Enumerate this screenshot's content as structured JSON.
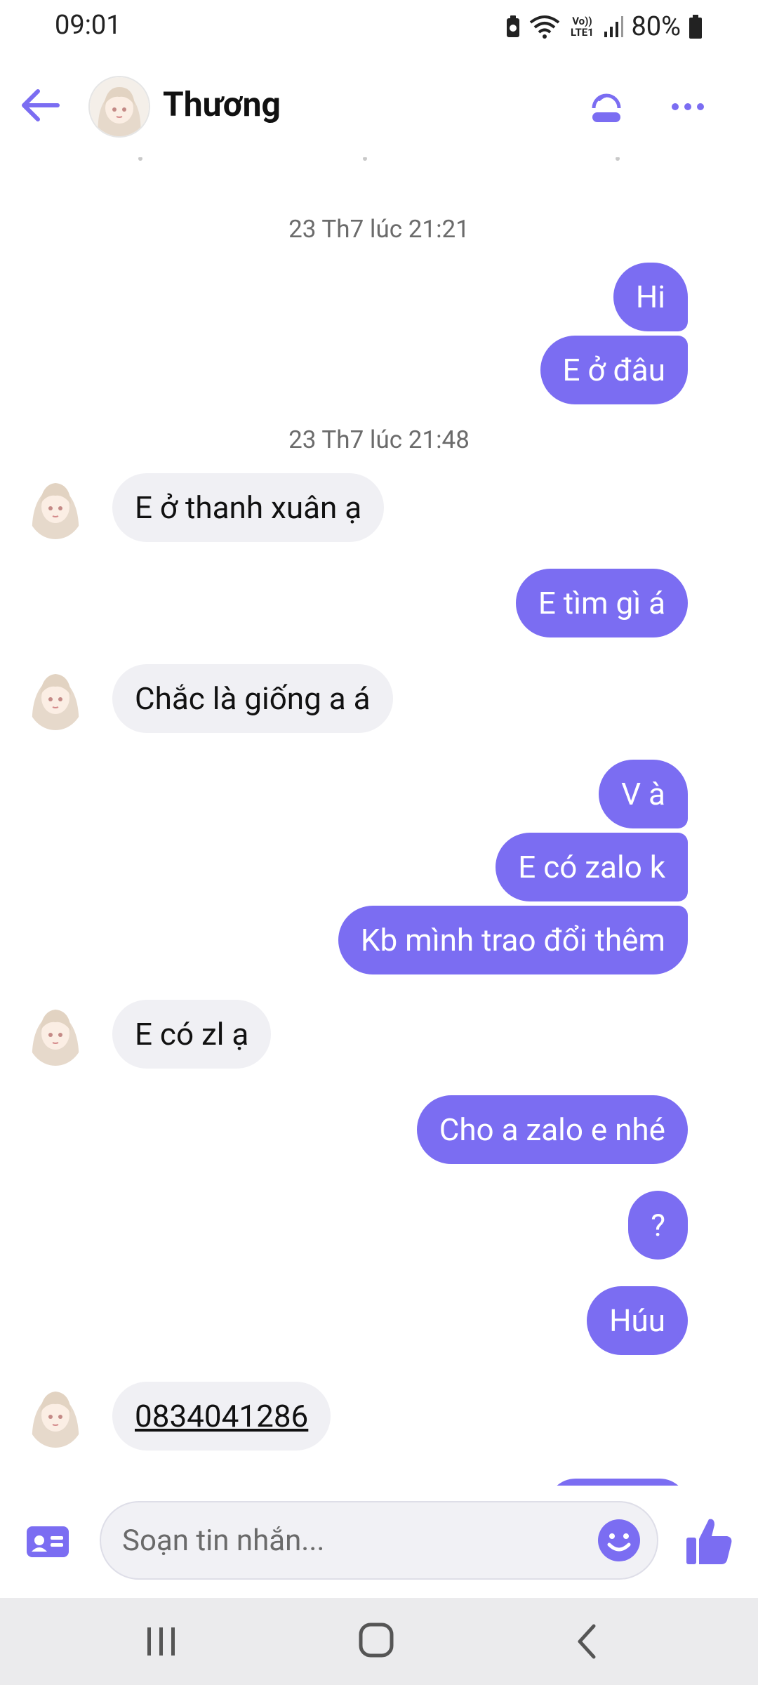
{
  "status": {
    "time": "09:01",
    "network": "Vo)) LTE1",
    "battery": "80%"
  },
  "header": {
    "contact_name": "Thương"
  },
  "composer": {
    "placeholder": "Soạn tin nhắn..."
  },
  "messages": [
    {
      "type": "timestamp",
      "text": "23 Th7 lúc 21:21"
    },
    {
      "type": "outgoing",
      "text": "Hi"
    },
    {
      "type": "outgoing",
      "text": "E ở đâu"
    },
    {
      "type": "timestamp",
      "text": "23 Th7 lúc 21:48"
    },
    {
      "type": "incoming",
      "text": "E ở thanh xuân ạ"
    },
    {
      "type": "outgoing",
      "text": "E tìm gì á"
    },
    {
      "type": "incoming",
      "text": "Chắc là giống a á"
    },
    {
      "type": "outgoing",
      "text": "V à"
    },
    {
      "type": "outgoing",
      "text": "E có zalo k"
    },
    {
      "type": "outgoing",
      "text": "Kb mình trao đổi thêm"
    },
    {
      "type": "incoming",
      "text": "E có zl ạ"
    },
    {
      "type": "outgoing",
      "text": "Cho a zalo e nhé"
    },
    {
      "type": "outgoing",
      "text": "?"
    },
    {
      "type": "outgoing",
      "text": "Húu"
    },
    {
      "type": "incoming",
      "text": "0834041286"
    }
  ],
  "colors": {
    "accent": "#7b6df2",
    "incoming_bubble": "#f0f0f4",
    "navbar": "#ebebed"
  },
  "icons": [
    "back-arrow-icon",
    "call-icon",
    "more-icon",
    "contact-card-icon",
    "emoji-icon",
    "thumbs-up-icon",
    "recent-apps-icon",
    "home-icon",
    "nav-back-icon",
    "wifi-icon",
    "signal-icon",
    "battery-icon"
  ]
}
